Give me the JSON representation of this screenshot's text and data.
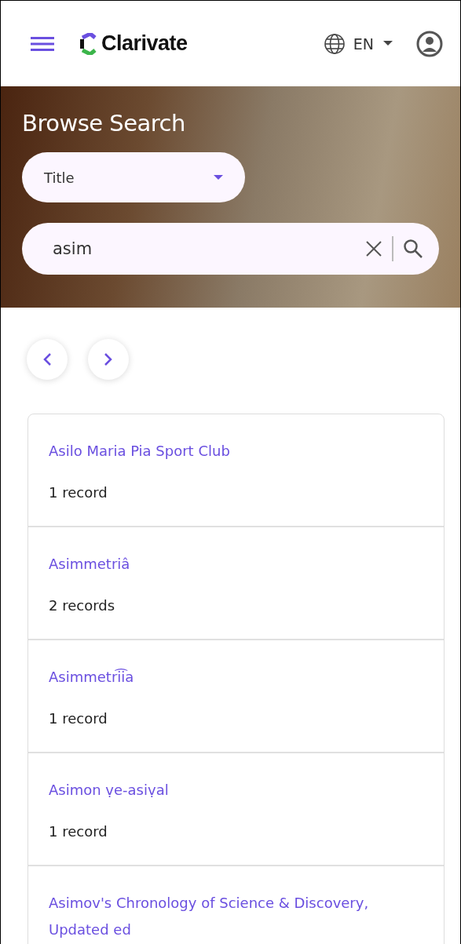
{
  "header": {
    "brand": "Clarivate",
    "language": "EN"
  },
  "hero": {
    "title": "Browse Search",
    "field_select": {
      "value": "Title"
    },
    "search": {
      "value": "asim"
    }
  },
  "results": [
    {
      "title": "Asilo Maria Pia Sport Club",
      "count": "1 record"
    },
    {
      "title": "Asimmetriâ",
      "count": "2 records"
    },
    {
      "title": "Asimmetri͡ia",
      "count": "1 record"
    },
    {
      "title": "Asimon ṿe-asiṿal",
      "count": "1 record"
    },
    {
      "title": "Asimov's Chronology of Science & Discovery, Updated ed"
    }
  ]
}
